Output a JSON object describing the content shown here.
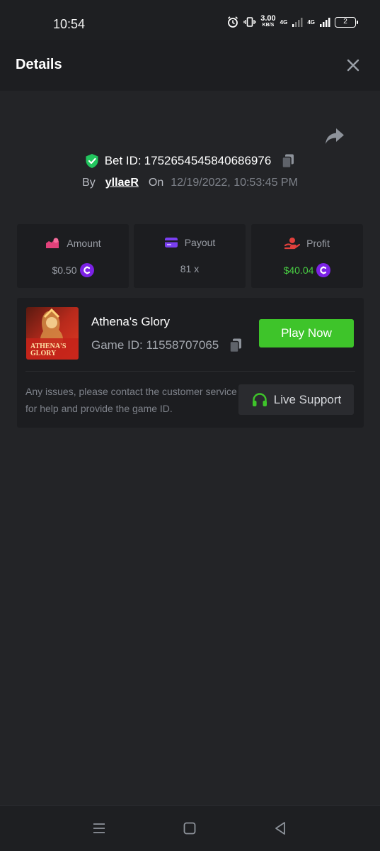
{
  "status_bar": {
    "time": "10:54",
    "speed_value": "3.00",
    "speed_unit": "KB/S",
    "network_1": "4G",
    "network_2": "4G",
    "battery_level": "2",
    "icons": [
      "alarm-icon",
      "vibrate-icon",
      "signal-icon"
    ]
  },
  "header": {
    "title": "Details",
    "close_icon": "close-icon"
  },
  "bet": {
    "label": "Bet ID:",
    "id": "1752654545840686976",
    "by_label": "By",
    "user": "yllaeR",
    "on_label": "On",
    "date": "12/19/2022, 10:53:45 PM"
  },
  "stats": [
    {
      "label": "Amount",
      "value": "$0.50",
      "icon": "amount-icon",
      "icon_color": "#e0417a",
      "has_coin": true,
      "value_color": "#9a9ea6"
    },
    {
      "label": "Payout",
      "value": "81 x",
      "icon": "wallet-icon",
      "icon_color": "#7a3ff0",
      "has_coin": false,
      "value_color": "#9a9ea6"
    },
    {
      "label": "Profit",
      "value": "$40.04",
      "icon": "profit-icon",
      "icon_color": "#e1403c",
      "has_coin": true,
      "value_color": "#49d043"
    }
  ],
  "game": {
    "name": "Athena's Glory",
    "id_label": "Game ID:",
    "id": "11558707065",
    "thumb_text_1": "ATHENA'S",
    "thumb_text_2": "GLORY",
    "play_label": "Play Now",
    "help_text": "Any issues, please contact the customer service for help and provide the game ID.",
    "support_label": "Live Support"
  },
  "colors": {
    "accent_green": "#3ec42a",
    "verified_green": "#22c55e",
    "coin_purple": "#7c22e6"
  }
}
